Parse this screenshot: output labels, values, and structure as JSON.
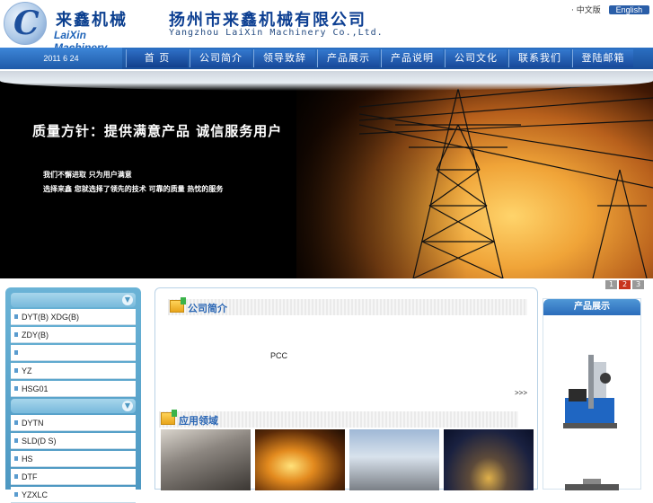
{
  "header": {
    "logo_cn": "来鑫机械",
    "logo_en": "LaiXin Machinery",
    "company_cn": "扬州市来鑫机械有限公司",
    "company_en": "Yangzhou LaiXin Machinery Co.,Ltd.",
    "lang_cn": "· 中文版",
    "lang_en": "English"
  },
  "nav": {
    "date": "2011 6 24",
    "items": [
      "首  页",
      "公司简介",
      "领导致辞",
      "产品展示",
      "产品说明",
      "公司文化",
      "联系我们",
      "登陆邮箱"
    ]
  },
  "banner": {
    "headline": "质量方针：提供满意产品    诚信服务用户",
    "sub1": "我们不懈进取    只为用户满意",
    "sub2": "选择来鑫    您就选择了领先的技术    可靠的质量    热忱的服务",
    "pages": [
      "1",
      "2",
      "3"
    ],
    "active_page": "2"
  },
  "sidebar": {
    "group1": [
      "DYT(B) XDG(B)",
      "ZDY(B)",
      "",
      "YZ",
      "HSG01"
    ],
    "group2": [
      "DYTN",
      "SLD(D S)",
      "HS",
      "DTF",
      "YZXLC"
    ]
  },
  "content": {
    "about_title": "公司简介",
    "about_text": "PCC",
    "more": ">>>",
    "apps_title": "应用领域"
  },
  "products": {
    "title": "产品展示"
  },
  "colors": {
    "brand_blue": "#1a4f9a",
    "accent_red": "#c8341d",
    "sidebar_blue": "#5aa5cd"
  }
}
